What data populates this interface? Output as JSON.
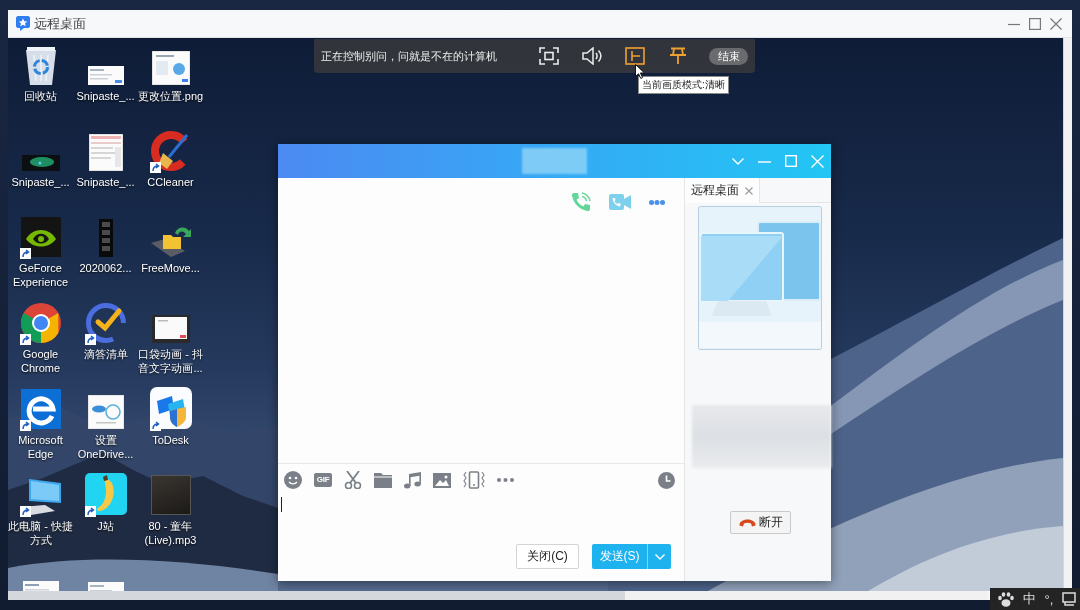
{
  "window": {
    "title": "远程桌面"
  },
  "desktop": {
    "icons": [
      {
        "label": "回收站",
        "kind": "recycle_bin",
        "shortcut": false
      },
      {
        "label": "Snipaste_...",
        "kind": "screenshot",
        "shortcut": false
      },
      {
        "label": "更改位置.png",
        "kind": "screenshot_page",
        "shortcut": false
      },
      {
        "label": "Snipaste_...",
        "kind": "screenshot_dark",
        "shortcut": false
      },
      {
        "label": "Snipaste_...",
        "kind": "screenshot_tall",
        "shortcut": false
      },
      {
        "label": "CCleaner",
        "kind": "broom_logo",
        "shortcut": true
      },
      {
        "label": "GeForce Experience",
        "kind": "eye_logo",
        "shortcut": true
      },
      {
        "label": "2020062...",
        "kind": "video",
        "shortcut": false
      },
      {
        "label": "FreeMove...",
        "kind": "folder_arrow",
        "shortcut": false
      },
      {
        "label": "Google Chrome",
        "kind": "browser",
        "shortcut": true
      },
      {
        "label": "滴答清单",
        "kind": "check_ring",
        "shortcut": true
      },
      {
        "label": "口袋动画 - 抖音文字动画...",
        "kind": "video_frame",
        "shortcut": false
      },
      {
        "label": "Microsoft Edge",
        "kind": "e_logo",
        "shortcut": true
      },
      {
        "label": "设置 OneDrive...",
        "kind": "screenshot_cloud",
        "shortcut": false
      },
      {
        "label": "ToDesk",
        "kind": "shield_tiles",
        "shortcut": true
      },
      {
        "label": "此电脑 - 快捷方式",
        "kind": "computer",
        "shortcut": true
      },
      {
        "label": "J站",
        "kind": "banana",
        "shortcut": true
      },
      {
        "label": "80 - 童年 (Live).mp3",
        "kind": "photo",
        "shortcut": false
      },
      {
        "kind": "screenshot_form",
        "shortcut": false
      },
      {
        "kind": "screenshot",
        "shortcut": false
      }
    ]
  },
  "remote_toolbar": {
    "status": "正在控制别问，问就是不在的计算机",
    "buttons": [
      {
        "kind": "fullscreen",
        "on": false
      },
      {
        "kind": "sound",
        "on": false
      },
      {
        "kind": "quality",
        "on": true
      },
      {
        "kind": "pin",
        "on": true
      }
    ],
    "end_button": "结束",
    "tooltip": "当前画质模式:清晰"
  },
  "chat_window": {
    "header_actions": [
      {
        "kind": "voice_call"
      },
      {
        "kind": "video_call"
      },
      {
        "kind": "more"
      }
    ],
    "toolbar": [
      {
        "kind": "emoji"
      },
      {
        "kind": "gif",
        "label": "GIF"
      },
      {
        "kind": "scissors"
      },
      {
        "kind": "folder"
      },
      {
        "kind": "music"
      },
      {
        "kind": "image"
      },
      {
        "kind": "shake"
      },
      {
        "kind": "more"
      }
    ],
    "close_button": "关闭(C)",
    "send_button": "发送(S)",
    "side_panel": {
      "tabs": [
        {
          "label": "远程桌面",
          "selected": true
        }
      ],
      "disconnect_button": "断开"
    }
  },
  "ime_bar": {
    "mode": "中",
    "punctuation": "°,"
  }
}
